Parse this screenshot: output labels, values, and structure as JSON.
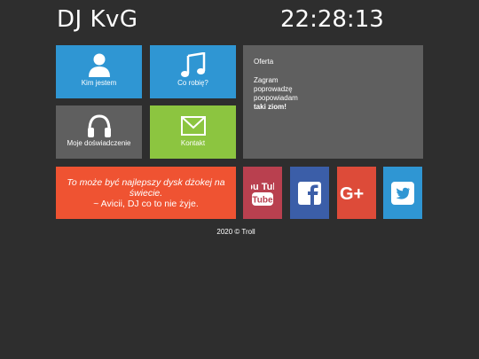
{
  "header": {
    "brand": "DJ KvG",
    "clock": "22:28:13"
  },
  "tiles": [
    {
      "label": "Kim jestem",
      "icon": "user-icon",
      "color": "#2f96d3"
    },
    {
      "label": "Co robię?",
      "icon": "music-note-icon",
      "color": "#2f96d3"
    },
    {
      "label": "Moje doświadczenie",
      "icon": "headphones-icon",
      "color": "#5f5f5f"
    },
    {
      "label": "Kontakt",
      "icon": "envelope-icon",
      "color": "#8cc540"
    }
  ],
  "offer": {
    "title": "Oferta",
    "lines": [
      "Zagram",
      "poprowadzę",
      "poopowiadam"
    ],
    "bold_line": "taki ziom!"
  },
  "quote": {
    "text": "To może być najlepszy dysk dżokej na świecie.",
    "author": "~ Avicii, DJ co to nie żyje.",
    "color": "#ef5332"
  },
  "social": [
    {
      "name": "YouTube",
      "icon": "youtube-icon",
      "text": "You Tube",
      "color": "#b9404f"
    },
    {
      "name": "Facebook",
      "icon": "facebook-icon",
      "text": "f",
      "color": "#3b5ea8"
    },
    {
      "name": "Google+",
      "icon": "google-plus-icon",
      "text": "G+",
      "color": "#dd4b39"
    },
    {
      "name": "Twitter",
      "icon": "twitter-icon",
      "color": "#2f96d3"
    }
  ],
  "footer": {
    "text": "2020 © Troll"
  }
}
